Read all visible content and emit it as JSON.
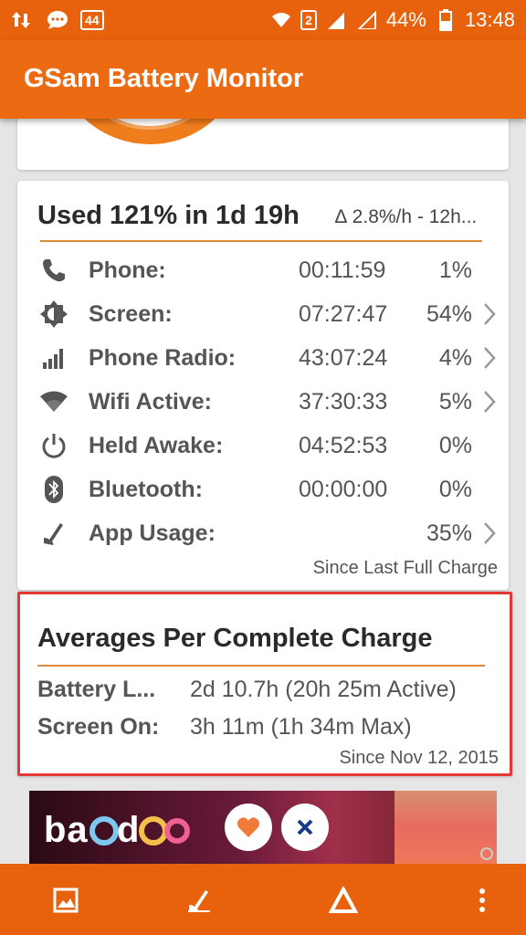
{
  "status_bar": {
    "notification_count": "44",
    "sim_slot": "2",
    "battery_percent": "44%",
    "time": "13:48"
  },
  "app_bar": {
    "title": "GSam Battery Monitor"
  },
  "usage": {
    "title": "Used 121% in 1d 19h",
    "delta": "∆ 2.8%/h - 12h...",
    "rows": [
      {
        "label": "Phone:",
        "time": "00:11:59",
        "percent": "1%",
        "icon": "phone-icon",
        "has_chevron": false
      },
      {
        "label": "Screen:",
        "time": "07:27:47",
        "percent": "54%",
        "icon": "brightness-icon",
        "has_chevron": true
      },
      {
        "label": "Phone Radio:",
        "time": "43:07:24",
        "percent": "4%",
        "icon": "signal-bars-icon",
        "has_chevron": true
      },
      {
        "label": "Wifi Active:",
        "time": "37:30:33",
        "percent": "5%",
        "icon": "wifi-icon",
        "has_chevron": true
      },
      {
        "label": "Held Awake:",
        "time": "04:52:53",
        "percent": "0%",
        "icon": "power-icon",
        "has_chevron": false
      },
      {
        "label": "Bluetooth:",
        "time": "00:00:00",
        "percent": "0%",
        "icon": "bluetooth-icon",
        "has_chevron": false
      },
      {
        "label": "App Usage:",
        "time": "",
        "percent": "35%",
        "icon": "app-usage-icon",
        "has_chevron": true
      }
    ],
    "since": "Since Last Full Charge"
  },
  "averages": {
    "title": "Averages Per Complete Charge",
    "battery_label": "Battery L...",
    "battery_value": "2d 10.7h (20h 25m Active)",
    "screen_label": "Screen On:",
    "screen_value": "3h 11m (1h 34m Max)",
    "since": "Since Nov 12, 2015"
  },
  "ad": {
    "brand": "badoo"
  },
  "colors": {
    "primary": "#e8620e",
    "accent_line": "#e08a3a",
    "highlight_border": "#e53935"
  }
}
